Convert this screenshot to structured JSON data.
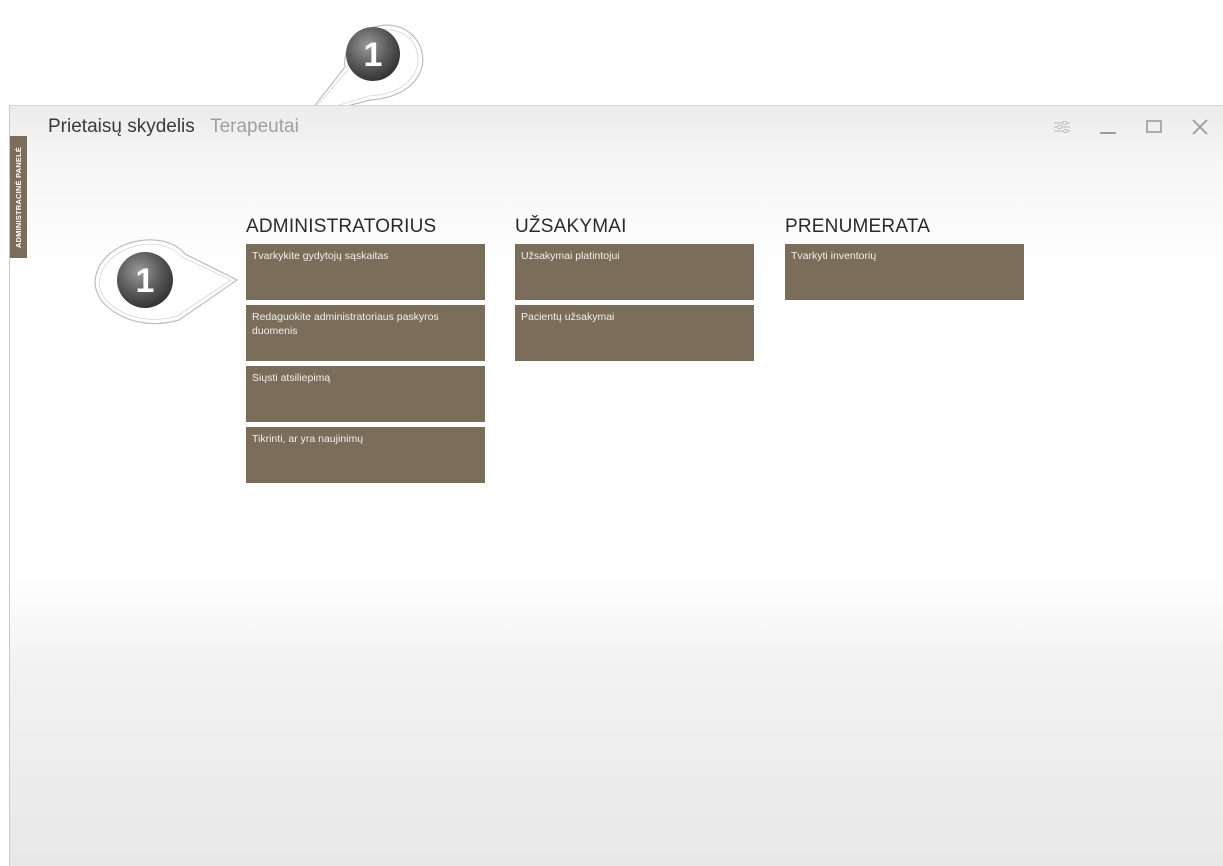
{
  "window": {
    "side_tab_label": "ADMINISTRACINĖ PANELĖ",
    "breadcrumb": {
      "current": "Prietaisų skydelis",
      "next": "Terapeutai"
    },
    "controls": [
      "settings-icon",
      "minimize-icon",
      "maximize-icon",
      "close-icon"
    ]
  },
  "sections": [
    {
      "title": "ADMINISTRATORIUS",
      "tiles": [
        "Tvarkykite gydytojų sąskaitas",
        "Redaguokite administratoriaus paskyros duomenis",
        "Siųsti atsiliepimą",
        "Tikrinti, ar yra naujinimų"
      ]
    },
    {
      "title": "UŽSAKYMAI",
      "tiles": [
        "Užsakymai platintojui",
        "Pacientų užsakymai"
      ]
    },
    {
      "title": "PRENUMERATA",
      "tiles": [
        "Tvarkyti inventorių"
      ]
    }
  ],
  "callouts": {
    "top_number": "1",
    "left_number": "1"
  },
  "colors": {
    "tile": "#7a6d5a",
    "tile_text": "#f3efe8",
    "heading": "#2a2a2a",
    "breadcrumb_inactive": "#a0a0a0"
  }
}
